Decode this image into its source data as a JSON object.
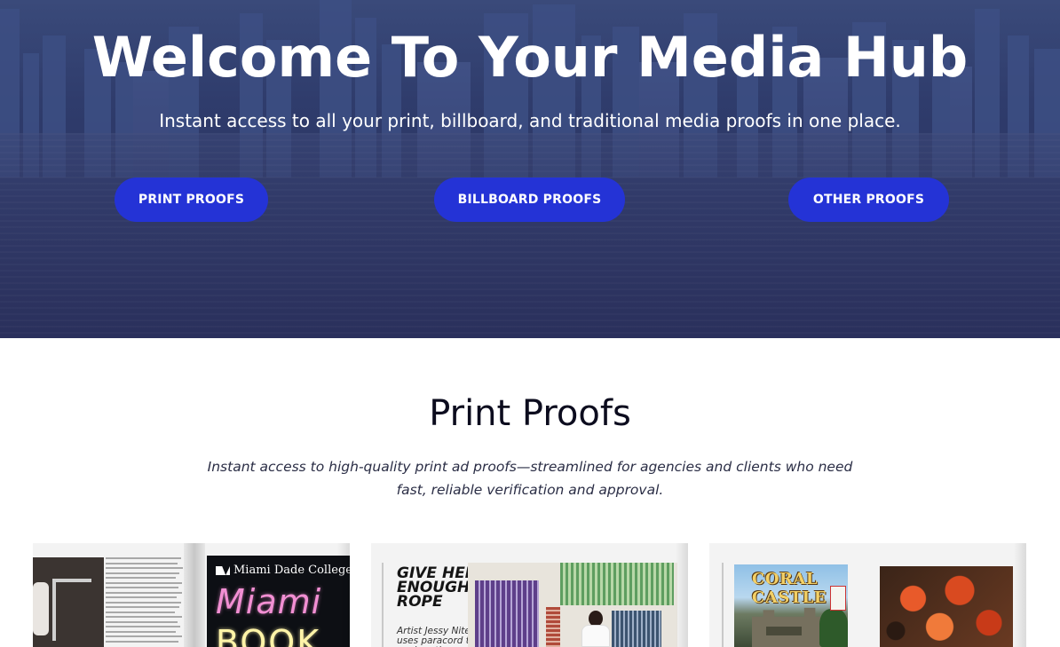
{
  "hero": {
    "title": "Welcome To Your Media Hub",
    "subtitle": "Instant access to all your print, billboard, and traditional media proofs in one place.",
    "buttons": [
      {
        "label": "PRINT PROOFS"
      },
      {
        "label": "BILLBOARD PROOFS"
      },
      {
        "label": "OTHER PROOFS"
      }
    ]
  },
  "section": {
    "title": "Print Proofs",
    "description": "Instant access to high-quality print ad proofs—streamlined for agencies and clients who need fast, reliable verification and approval."
  },
  "cards": [
    {
      "ad_brand": "Miami Dade College",
      "ad_words": [
        "Miami",
        "BOOK"
      ]
    },
    {
      "headline": "GIVE HER ENOUGH ROPE",
      "caption": "Artist Jessy Nite uses paracord to explore themes of survival."
    },
    {
      "cover_title": "CORAL CASTLE"
    }
  ],
  "colors": {
    "accent": "#2433d6",
    "hero_bg": "#2b3463",
    "title_text": "#0c0c1e"
  }
}
